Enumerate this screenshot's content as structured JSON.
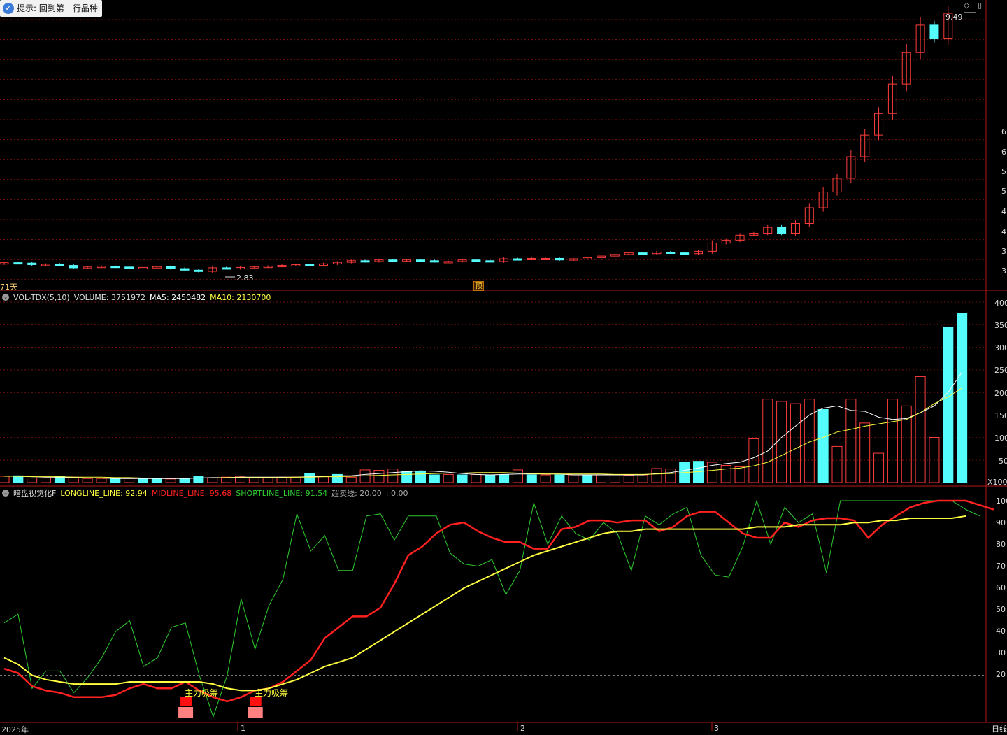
{
  "hint": {
    "icon": "check-icon",
    "text": "提示:  回到第一行品种"
  },
  "price_panel": {
    "period_label": "71天",
    "high_label": "9.49",
    "low_label": "2.83",
    "pre_badge": "预",
    "right_axis": [
      "6",
      "6",
      "5",
      "5",
      "4",
      "4",
      "3",
      "3"
    ]
  },
  "volume_panel": {
    "title": "VOL-TDX(5,10)",
    "volume_label": "VOLUME: 3751972",
    "ma5_label": "MA5: 2450482",
    "ma10_label": "MA10: 2130700",
    "right_axis": [
      "400",
      "350",
      "300",
      "250",
      "200",
      "150",
      "100",
      "50"
    ],
    "unit": "X100"
  },
  "indicator_panel": {
    "title": "暗盘视觉化F",
    "long_label": "LONGLINE_LINE: 92.94",
    "mid_label": "MIDLINE_LINE: 95.68",
    "short_label": "SHORTLINE_LINE: 91.54",
    "oversold_label": "超卖线: 20.00",
    "extra_label": ": 0.00",
    "right_axis": [
      "100",
      "90",
      "80",
      "70",
      "60",
      "50",
      "40",
      "30",
      "20"
    ],
    "signal_text": "主力吸筹"
  },
  "x_axis": {
    "labels": [
      "2025年",
      "1",
      "2",
      "3"
    ],
    "period_button": "日线"
  },
  "colors": {
    "up": "#ff3c3c",
    "down": "#54fcfc",
    "ma5": "#ffffff",
    "ma10": "#ffff40",
    "long": "#ffff40",
    "mid": "#ff2020",
    "short": "#2ecc2e",
    "grid": "#7a1010",
    "signal": "#ff2020"
  },
  "chart_data": [
    {
      "type": "candlestick",
      "title": "",
      "closes": [
        3.05,
        3.04,
        3.0,
        3.01,
        2.98,
        2.92,
        2.94,
        2.96,
        2.94,
        2.92,
        2.93,
        2.95,
        2.9,
        2.86,
        2.83,
        2.92,
        2.9,
        2.93,
        2.95,
        2.96,
        2.98,
        3.0,
        2.98,
        3.02,
        3.06,
        3.1,
        3.08,
        3.12,
        3.1,
        3.12,
        3.1,
        3.08,
        3.08,
        3.12,
        3.1,
        3.08,
        3.15,
        3.14,
        3.16,
        3.16,
        3.12,
        3.15,
        3.18,
        3.22,
        3.26,
        3.3,
        3.28,
        3.32,
        3.3,
        3.28,
        3.34,
        3.55,
        3.62,
        3.75,
        3.8,
        3.95,
        3.8,
        4.05,
        4.45,
        4.85,
        5.2,
        5.75,
        6.3,
        6.85,
        7.6,
        8.4,
        9.1,
        8.75,
        9.4
      ],
      "high": 9.49,
      "low": 2.83
    },
    {
      "type": "bar",
      "title": "",
      "unit": "X100",
      "ylim": [
        0,
        400
      ],
      "values": [
        14,
        15,
        10,
        10,
        14,
        12,
        9,
        9,
        8,
        9,
        8,
        9,
        8,
        10,
        14,
        10,
        12,
        14,
        10,
        10,
        12,
        12,
        20,
        13,
        18,
        12,
        28,
        27,
        30,
        25,
        25,
        17,
        18,
        17,
        18,
        17,
        17,
        28,
        17,
        17,
        17,
        17,
        17,
        17,
        17,
        16,
        17,
        31,
        30,
        45,
        47,
        45,
        38,
        35,
        97,
        185,
        180,
        175,
        185,
        162,
        80,
        185,
        132,
        65,
        185,
        170,
        235,
        100,
        345,
        375
      ],
      "up": [
        1,
        0,
        1,
        1,
        0,
        1,
        1,
        1,
        0,
        1,
        0,
        0,
        1,
        0,
        0,
        1,
        1,
        1,
        1,
        1,
        1,
        1,
        0,
        1,
        0,
        1,
        1,
        1,
        1,
        0,
        0,
        0,
        1,
        0,
        1,
        0,
        0,
        1,
        0,
        1,
        0,
        1,
        0,
        1,
        1,
        1,
        1,
        1,
        1,
        0,
        0,
        1,
        1,
        1,
        1,
        1,
        1,
        1,
        1,
        0,
        1,
        1,
        1,
        1,
        1,
        1,
        1,
        1,
        0,
        0
      ],
      "ma5": [
        14,
        14,
        13,
        12,
        12,
        11,
        10,
        10,
        9,
        9,
        9,
        9,
        9,
        9,
        10,
        11,
        11,
        12,
        12,
        12,
        12,
        12,
        13,
        14,
        15,
        15,
        18,
        20,
        22,
        24,
        26,
        25,
        23,
        20,
        18,
        17,
        18,
        19,
        19,
        19,
        19,
        17,
        17,
        17,
        17,
        17,
        17,
        20,
        22,
        27,
        32,
        38,
        42,
        45,
        55,
        70,
        100,
        125,
        150,
        165,
        170,
        160,
        158,
        145,
        140,
        142,
        155,
        170,
        200,
        245
      ],
      "ma10": [
        14,
        14,
        13,
        13,
        13,
        12,
        12,
        12,
        11,
        11,
        10,
        10,
        10,
        10,
        10,
        10,
        11,
        11,
        11,
        11,
        11,
        12,
        12,
        13,
        13,
        14,
        15,
        16,
        17,
        18,
        19,
        20,
        21,
        21,
        22,
        22,
        22,
        21,
        20,
        19,
        19,
        19,
        19,
        19,
        18,
        18,
        18,
        19,
        20,
        22,
        24,
        27,
        30,
        32,
        37,
        45,
        60,
        75,
        90,
        100,
        112,
        118,
        125,
        130,
        135,
        140,
        155,
        175,
        190,
        210
      ]
    },
    {
      "type": "line",
      "title": "",
      "ylim": [
        0,
        105
      ],
      "series": [
        {
          "name": "LONGLINE_LINE",
          "values": [
            28,
            25,
            20,
            18,
            17,
            16,
            16,
            16,
            16,
            17,
            17,
            17,
            17,
            17,
            17,
            16,
            14,
            13,
            13,
            14,
            16,
            18,
            21,
            24,
            26,
            28,
            32,
            36,
            40,
            44,
            48,
            52,
            56,
            60,
            63,
            66,
            69,
            72,
            75,
            77,
            79,
            81,
            83,
            85,
            86,
            86,
            87,
            87,
            87,
            87,
            87,
            87,
            87,
            87,
            88,
            88,
            88,
            89,
            89,
            89,
            89,
            90,
            90,
            91,
            91,
            92,
            92,
            92,
            92,
            93
          ]
        },
        {
          "name": "MIDLINE_LINE",
          "values": [
            23,
            21,
            15,
            13,
            12,
            10,
            10,
            10,
            11,
            14,
            16,
            14,
            14,
            17,
            13,
            10,
            8,
            10,
            13,
            14,
            17,
            22,
            27,
            37,
            42,
            47,
            47,
            51,
            62,
            75,
            79,
            85,
            89,
            90,
            86,
            83,
            81,
            81,
            78,
            78,
            87,
            88,
            91,
            91,
            90,
            91,
            91,
            86,
            88,
            93,
            95,
            95,
            90,
            85,
            83,
            83,
            90,
            88,
            91,
            92,
            92,
            91,
            83,
            89,
            93,
            97,
            99,
            100,
            100,
            100,
            98,
            96
          ]
        },
        {
          "name": "SHORTLINE_LINE",
          "values": [
            44,
            48,
            14,
            22,
            22,
            12,
            19,
            28,
            40,
            45,
            24,
            28,
            42,
            44,
            20,
            1,
            20,
            55,
            32,
            52,
            64,
            94,
            77,
            84,
            68,
            68,
            93,
            94,
            82,
            93,
            93,
            93,
            76,
            71,
            70,
            73,
            57,
            68,
            99,
            80,
            93,
            85,
            82,
            90,
            85,
            68,
            93,
            89,
            94,
            97,
            75,
            66,
            65,
            79,
            100,
            80,
            97,
            90,
            94,
            67,
            100,
            100,
            100,
            100,
            100,
            100,
            100,
            100,
            100,
            96,
            93
          ]
        },
        {
          "name": "超卖线",
          "values": [
            20
          ]
        }
      ],
      "signals": [
        13,
        18
      ]
    }
  ]
}
